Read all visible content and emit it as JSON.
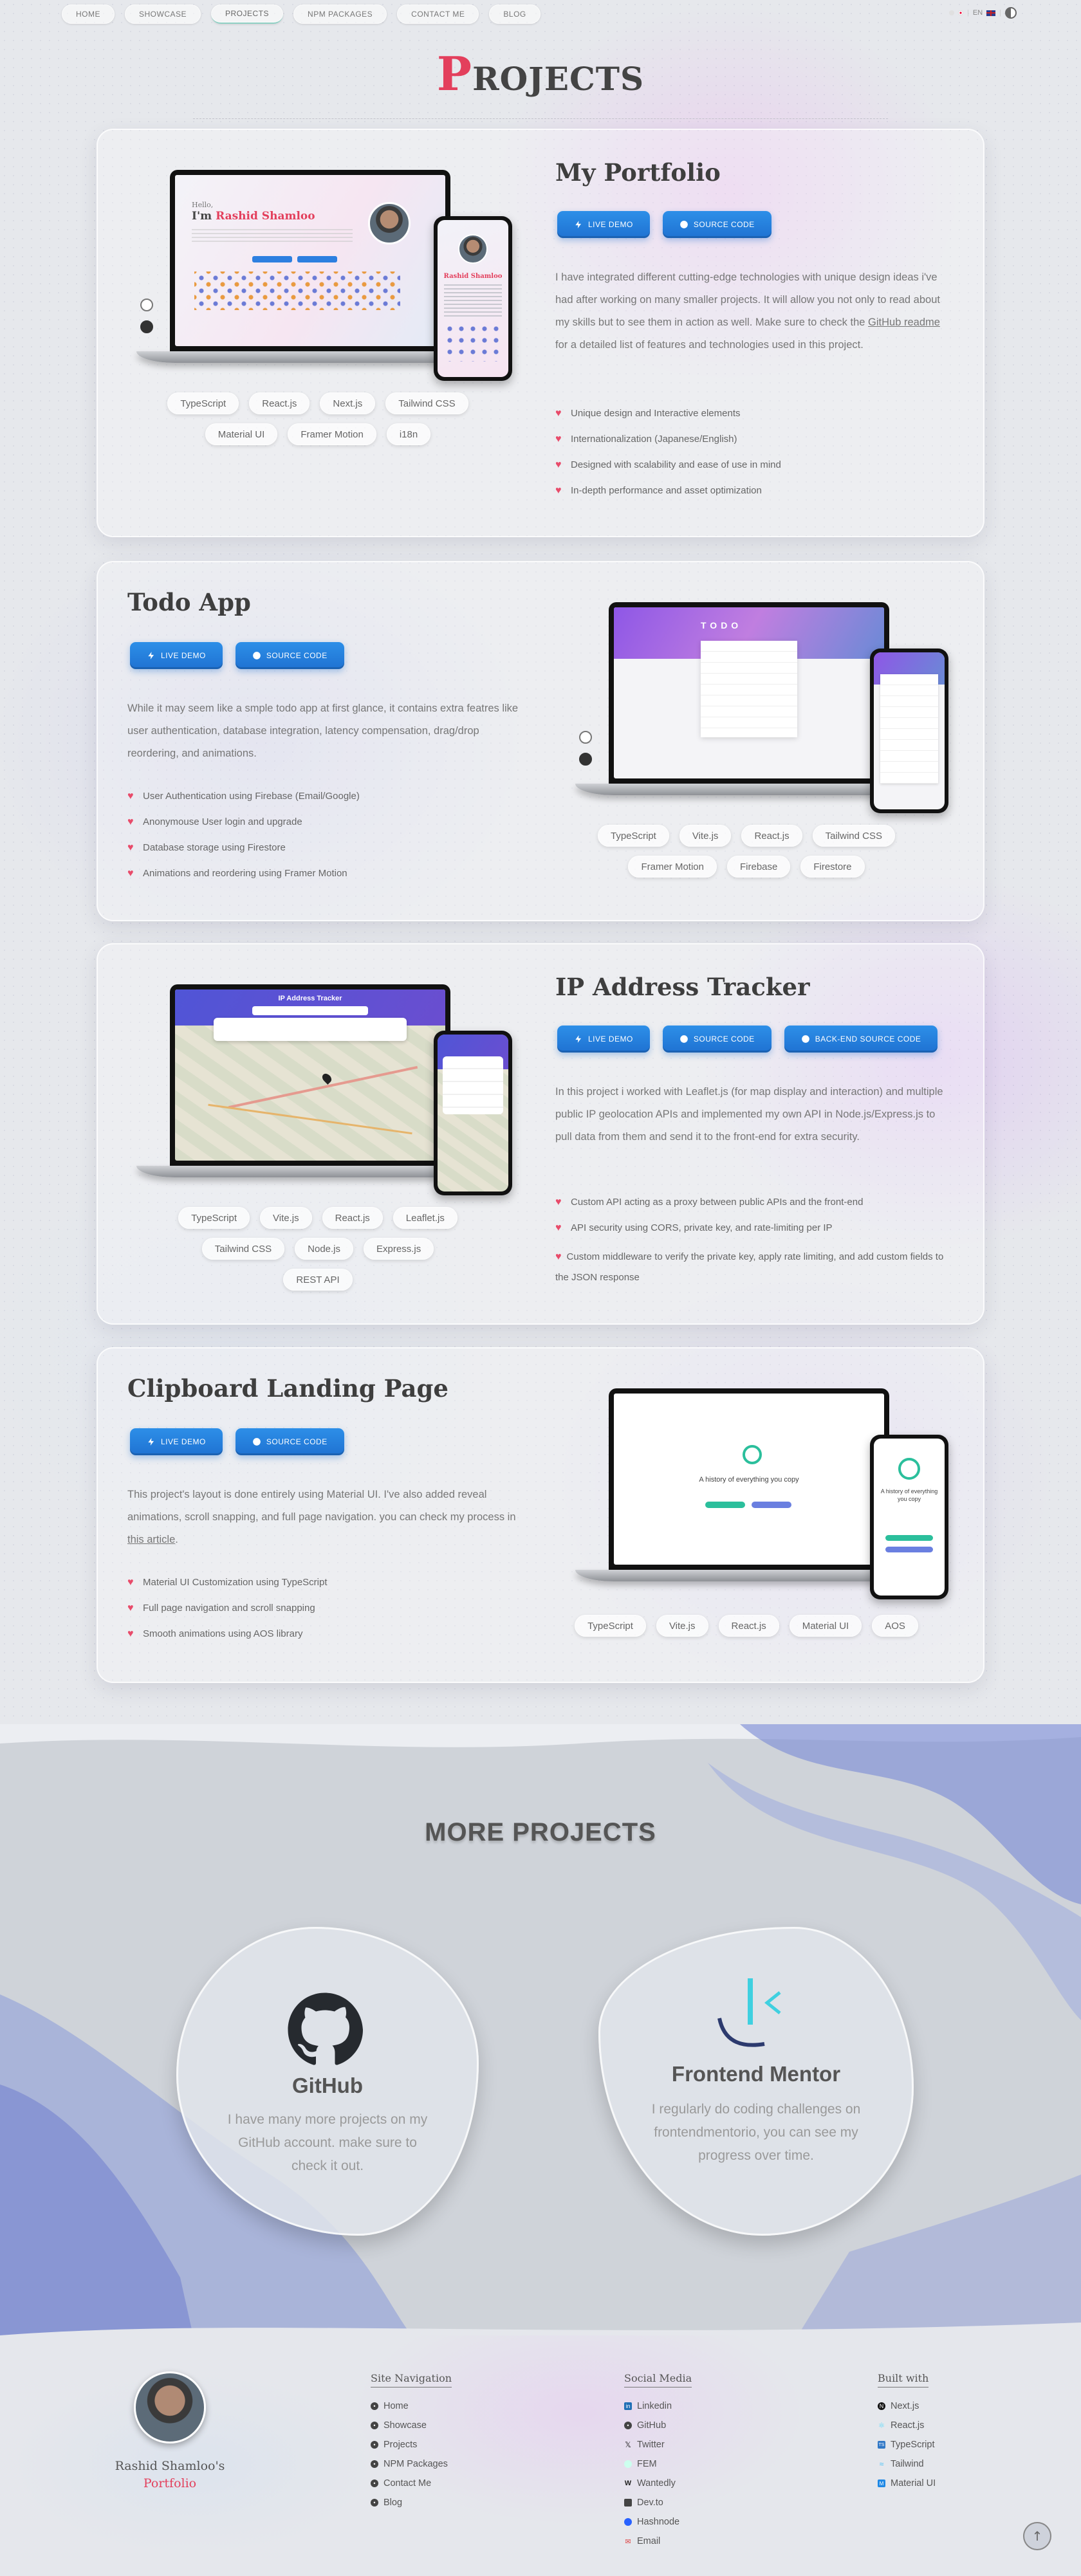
{
  "nav": {
    "links": [
      "HOME",
      "SHOWCASE",
      "PROJECTS",
      "NPM PACKAGES",
      "CONTACT ME",
      "BLOG"
    ],
    "lang_label": "EN"
  },
  "page_title_first": "P",
  "page_title_rest": "ROJECTS",
  "projects": [
    {
      "title": "My Portfolio",
      "buttons": [
        "LIVE DEMO",
        "SOURCE CODE"
      ],
      "desc_before": "I have integrated different cutting-edge technologies with unique design ideas i've had after working on many smaller projects. It will allow you not only to read about my skills but to see them in action as well. Make sure to check the ",
      "desc_link": "GitHub readme",
      "desc_after": " for a detailed list of features and technologies used in this project.",
      "features": [
        "Unique design and Interactive elements",
        "Internationalization (Japanese/English)",
        "Designed with scalability and ease of use in mind",
        "In-depth performance and asset optimization"
      ],
      "tags": [
        "TypeScript",
        "React.js",
        "Next.js",
        "Tailwind CSS",
        "Material UI",
        "Framer Motion",
        "i18n"
      ],
      "screen_text": {
        "hello": "Hello,",
        "im": "I'm ",
        "name": "Rashid Shamloo",
        "phone_name": "Rashid Shamloo"
      }
    },
    {
      "title": "Todo App",
      "buttons": [
        "LIVE DEMO",
        "SOURCE CODE"
      ],
      "desc": "While it may seem like a smple todo app at first glance, it contains extra featres like user authentication, database integration, latency compensation, drag/drop reordering, and animations.",
      "features": [
        "User Authentication using Firebase (Email/Google)",
        "Anonymouse User login and upgrade",
        "Database storage using Firestore",
        "Animations and reordering using Framer Motion"
      ],
      "tags": [
        "TypeScript",
        "Vite.js",
        "React.js",
        "Tailwind CSS",
        "Framer Motion",
        "Firebase",
        "Firestore"
      ],
      "screen_text": {
        "heading": "TODO"
      }
    },
    {
      "title": "IP Address Tracker",
      "buttons": [
        "LIVE DEMO",
        "SOURCE CODE",
        "BACK-END SOURCE CODE"
      ],
      "desc": "In this project i worked with Leaflet.js (for map display and interaction) and multiple public IP geolocation APIs and implemented my own API in Node.js/Express.js to pull data from them and send it to the front-end for extra security.",
      "features": [
        "Custom API acting as a proxy between public APIs and the front-end",
        "API security using CORS, private key, and rate-limiting per IP",
        "Custom middleware to verify the private key, apply rate limiting, and add custom fields to the JSON response"
      ],
      "tags": [
        "TypeScript",
        "Vite.js",
        "React.js",
        "Leaflet.js",
        "Tailwind CSS",
        "Node.js",
        "Express.js",
        "REST API"
      ],
      "screen_text": {
        "heading": "IP Address Tracker"
      }
    },
    {
      "title": "Clipboard Landing Page",
      "buttons": [
        "LIVE DEMO",
        "SOURCE CODE"
      ],
      "desc_before": "This project's layout is done entirely using Material UI. I've also added reveal animations, scroll snapping, and full page navigation. you can check my process in ",
      "desc_link": "this article",
      "desc_after": ".",
      "features": [
        "Material UI Customization using TypeScript",
        "Full page navigation and scroll snapping",
        "Smooth animations using AOS library"
      ],
      "tags": [
        "TypeScript",
        "Vite.js",
        "React.js",
        "Material UI",
        "AOS"
      ],
      "screen_text": {
        "heading": "A history of everything you copy"
      }
    }
  ],
  "more": {
    "title": "MORE PROJECTS",
    "github": {
      "title": "GitHub",
      "text": "I have many more projects on my GitHub account. make sure to check it out."
    },
    "fem": {
      "title": "Frontend Mentor",
      "text": "I regularly do coding challenges on frontendmentorio, you can see my progress over time."
    }
  },
  "footer": {
    "name": "Rashid Shamloo's",
    "portfolio": "Portfolio",
    "site_nav": {
      "title": "Site Navigation",
      "items": [
        "Home",
        "Showcase",
        "Projects",
        "NPM Packages",
        "Contact Me",
        "Blog"
      ]
    },
    "social": {
      "title": "Social Media",
      "items": [
        "Linkedin",
        "GitHub",
        "Twitter",
        "FEM",
        "Wantedly",
        "Dev.to",
        "Hashnode",
        "Email"
      ]
    },
    "built": {
      "title": "Built with",
      "items": [
        "Next.js",
        "React.js",
        "TypeScript",
        "Tailwind",
        "Material UI"
      ]
    }
  },
  "colors": {
    "accent": "#e33f5c",
    "button": "#1f72d2"
  }
}
